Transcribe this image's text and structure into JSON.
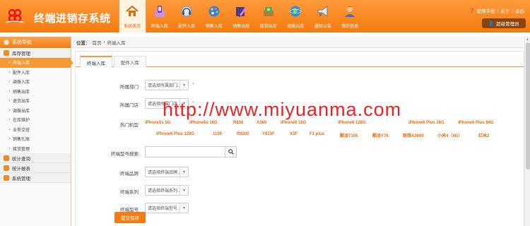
{
  "app": {
    "title": "终端进销存系统"
  },
  "header": {
    "nav": [
      {
        "label": "系统首页",
        "icon": "home-icon",
        "color": "#d76b0c",
        "active": true
      },
      {
        "label": "终端入库",
        "icon": "phone-box-icon",
        "color": "#8a56c8"
      },
      {
        "label": "配件入库",
        "icon": "headset-icon",
        "color": "#6b9ad6"
      },
      {
        "label": "销售入库",
        "icon": "palette-icon",
        "color": "#3c7fd0"
      },
      {
        "label": "销售出库",
        "icon": "pen-icon",
        "color": "#8a56c8"
      },
      {
        "label": "接货出库",
        "icon": "money-box-icon",
        "color": "#4caf50"
      },
      {
        "label": "调拨出库",
        "icon": "globe-icon",
        "color": "#2d8fd8"
      },
      {
        "label": "通知公告",
        "icon": "megaphone-icon",
        "color": "#777777"
      },
      {
        "label": "我的信息",
        "icon": "user-icon",
        "color": "#c47a3a"
      }
    ],
    "top_links": {
      "help": "使用手册",
      "about": "关于",
      "logout": "退出"
    },
    "admin_label": "超级管理员"
  },
  "sidebar": {
    "title": "系统导航",
    "group_inventory": "库存管理",
    "items": [
      {
        "label": "终端入库",
        "active": true
      },
      {
        "label": "配件入库"
      },
      {
        "label": "调拨入库"
      },
      {
        "label": "销售出库"
      },
      {
        "label": "退货出库"
      },
      {
        "label": "调拨出库"
      },
      {
        "label": "在库维护"
      },
      {
        "label": "业务交班"
      },
      {
        "label": "销售扎账"
      },
      {
        "label": "接货管理"
      }
    ],
    "group_stats": "统计查询",
    "group_reports": "统计报表",
    "group_system": "系统管理"
  },
  "breadcrumb": {
    "label": "位置：",
    "home": "首页",
    "sep": "›",
    "current": "终端入库"
  },
  "tabs": [
    {
      "label": "终端入库",
      "active": true
    },
    {
      "label": "配件入库"
    }
  ],
  "form": {
    "department_label": "所属部门",
    "department_value": "请选择所属部门...",
    "store_label": "所属门店",
    "store_value": "请选择所属门店...",
    "required_mark": "*",
    "hot_models_label": "热门机型",
    "hot_models": [
      "iPhone5s 5G",
      "iPhone5s 16G",
      "R830",
      "A360",
      "iPhone6 16G",
      "iPhone6 128G",
      "iPhone6 Plus 16G",
      "iPhone6 Plus 64G",
      "iPhone6 Plus 128G",
      "1100",
      "R8200",
      "Y613F",
      "X3F",
      "F1 plus",
      "酷派7105",
      "酷派Y76",
      "联想A3600",
      "小米4（4G）",
      "红米2"
    ],
    "model_search_label": "终端型号搜索",
    "model_search_placeholder": "",
    "brand_label": "终端品牌",
    "brand_value": "请选择终端品牌...",
    "series_label": "终端系列",
    "series_value": "请选择终端系列...",
    "model_label": "终端型号",
    "model_value": "请选择终端型号...",
    "submit_label": "提交保存"
  },
  "watermark": "http://www.miyuanma.com"
}
